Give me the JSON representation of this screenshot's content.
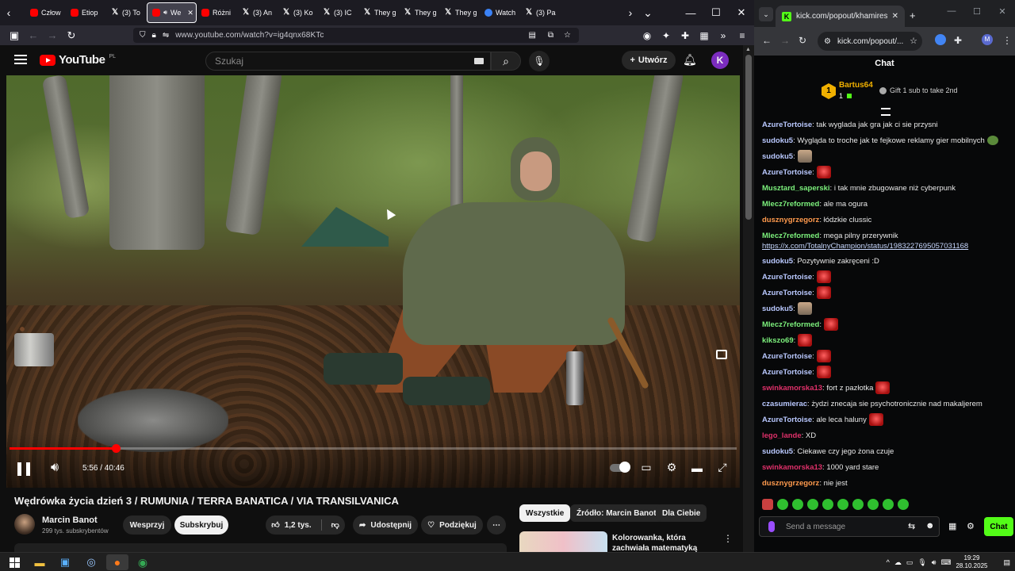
{
  "left_browser": {
    "tabs": [
      {
        "label": "Człow",
        "icon": "youtube-icon"
      },
      {
        "label": "Etiop",
        "icon": "youtube-icon"
      },
      {
        "label": "(3) To",
        "icon": "x-icon"
      },
      {
        "label": "We",
        "icon": "youtube-icon",
        "active": true
      },
      {
        "label": "Różni",
        "icon": "youtube-icon"
      },
      {
        "label": "(3) An",
        "icon": "x-icon"
      },
      {
        "label": "(3) Ko",
        "icon": "x-icon"
      },
      {
        "label": "(3) IC",
        "icon": "x-icon"
      },
      {
        "label": "They g",
        "icon": "x-icon"
      },
      {
        "label": "They g",
        "icon": "x-icon"
      },
      {
        "label": "They g",
        "icon": "x-icon"
      },
      {
        "label": "Watch",
        "icon": "globe-icon"
      },
      {
        "label": "(3) Pa",
        "icon": "x-icon"
      }
    ],
    "url": "www.youtube.com/watch?v=ig4qnx68KTc"
  },
  "youtube": {
    "logo_text": "YouTube",
    "country": "PL",
    "search_placeholder": "Szukaj",
    "create_label": "Utwórz",
    "avatar_letter": "K",
    "video": {
      "time": "5:56 / 40:46",
      "progress_fraction": 0.1456,
      "buffer_fraction": 0.1456
    },
    "title": "Wędrówka życia dzień 3 / RUMUNIA / TERRA BANATICA / VIA TRANSILVANICA",
    "channel": "Marcin Banot",
    "subscribers": "299 tys. subskrybentów",
    "support_label": "Wesprzyj",
    "subscribe_label": "Subskrybuj",
    "likes": "1,2 tys.",
    "share_label": "Udostępnij",
    "thanks_label": "Podziękuj",
    "chips": [
      "Wszystkie",
      "Źródło: Marcin Banot",
      "Dla Ciebie"
    ],
    "recommendation_title": "Kolorowanka, która zachwiała matematyką"
  },
  "right_browser": {
    "tab_title": "kick.com/popout/khamires/chat",
    "url": "kick.com/popout/...",
    "profile_letter": "M"
  },
  "chat": {
    "header": "Chat",
    "pinned_user": "Bartus64",
    "pinned_count": "1",
    "pinned_rank": "1",
    "gift_text": "Gift 1 sub to take 2nd",
    "messages": [
      {
        "user": "AzureTortoise",
        "color": "#b9c8ff",
        "text": ": tak wyglada jak gra jak ci sie przysni"
      },
      {
        "user": "sudoku5",
        "color": "#b9c8ff",
        "text": ": Wygląda to troche jak te fejkowe reklamy gier mobilnych"
      },
      {
        "user": "sudoku5",
        "color": "#b9c8ff",
        "text": ":"
      },
      {
        "user": "AzureTortoise",
        "color": "#b9c8ff",
        "text": ":"
      },
      {
        "user": "Musztard_saperski",
        "color": "#7cf07c",
        "text": ": i tak mnie zbugowane niż cyberpunk"
      },
      {
        "user": "Mlecz7reformed",
        "color": "#7cf07c",
        "text": ": ale ma ogura"
      },
      {
        "user": "dusznygrzegorz",
        "color": "#ff9a4d",
        "text": ": łódzkie clussic"
      },
      {
        "user": "Mlecz7reformed",
        "color": "#7cf07c",
        "text": ": mega pilny przerywnik",
        "link": "https://x.com/TotalnyChampion/status/1983227695057031168"
      },
      {
        "user": "sudoku5",
        "color": "#b9c8ff",
        "text": ": Pozytywnie zakręceni :D"
      },
      {
        "user": "AzureTortoise",
        "color": "#b9c8ff",
        "text": ":"
      },
      {
        "user": "AzureTortoise",
        "color": "#b9c8ff",
        "text": ":"
      },
      {
        "user": "sudoku5",
        "color": "#b9c8ff",
        "text": ":"
      },
      {
        "user": "Mlecz7reformed",
        "color": "#7cf07c",
        "text": ":"
      },
      {
        "user": "kikszo69",
        "color": "#7cf07c",
        "text": ":"
      },
      {
        "user": "AzureTortoise",
        "color": "#b9c8ff",
        "text": ":"
      },
      {
        "user": "AzureTortoise",
        "color": "#b9c8ff",
        "text": ":"
      },
      {
        "user": "swinkamorska13",
        "color": "#e0306a",
        "text": ": fort z pazłotka"
      },
      {
        "user": "czasumierac",
        "color": "#b9c8ff",
        "text": ": żydzi znecaja sie psychotronicznie nad makaljerem"
      },
      {
        "user": "AzureTortoise",
        "color": "#b9c8ff",
        "text": ": ale leca haluny"
      },
      {
        "user": "lego_lande",
        "color": "#e0306a",
        "text": ": XD"
      },
      {
        "user": "sudoku5",
        "color": "#b9c8ff",
        "text": ": Ciekawe czy jego żona czuje"
      },
      {
        "user": "swinkamorska13",
        "color": "#e0306a",
        "text": ": 1000 yard stare"
      },
      {
        "user": "dusznygrzegorz",
        "color": "#ff9a4d",
        "text": ": nie jest"
      }
    ],
    "input_placeholder": "Send a message",
    "send_label": "Chat"
  },
  "taskbar": {
    "time": "19:29",
    "date": "28.10.2025"
  }
}
